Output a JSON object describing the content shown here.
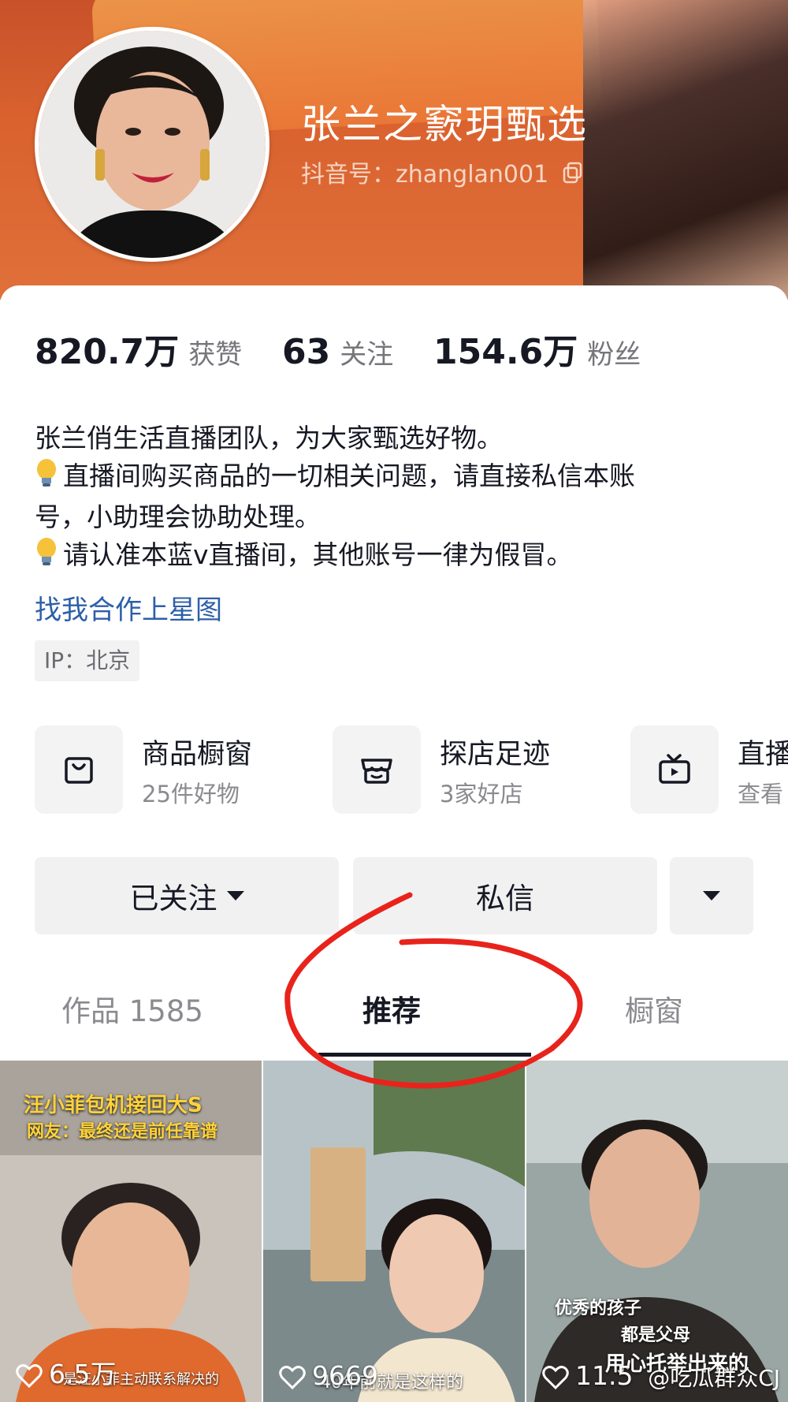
{
  "profile": {
    "name": "张兰之窾玥甄选",
    "douyin_id": "抖音号：zhanglan001"
  },
  "stats": [
    {
      "num": "820.7万",
      "label": "获赞"
    },
    {
      "num": "63",
      "label": "关注"
    },
    {
      "num": "154.6万",
      "label": "粉丝"
    }
  ],
  "bio": {
    "line1": "张兰俏生活直播团队，为大家甄选好物。",
    "line2": "直播间购买商品的一切相关问题，请直接私信本账",
    "line3": "号，小助理会协助处理。",
    "line4": "请认准本蓝v直播间，其他账号一律为假冒。"
  },
  "xingtu_link": "找我合作上星图",
  "ip_tag": "IP：北京",
  "features": [
    {
      "title": "商品橱窗",
      "sub": "25件好物",
      "icon": "shopping-bag-icon"
    },
    {
      "title": "探店足迹",
      "sub": "3家好店",
      "icon": "store-icon"
    },
    {
      "title": "直播",
      "sub": "查看",
      "icon": "tv-icon"
    }
  ],
  "buttons": {
    "follow": "已关注",
    "message": "私信"
  },
  "tabs": {
    "works": "作品 1585",
    "recommend": "推荐",
    "showcase": "橱窗"
  },
  "videos": [
    {
      "likes": "6.5万",
      "title1": "汪小菲包机接回大S",
      "title2": "网友：最终还是前任靠谱",
      "subtitle": "是汪小菲主动联系解决的"
    },
    {
      "likes": "9669",
      "subtitle": "40年前就是这样的"
    },
    {
      "likes": "11.5",
      "subtitle1": "优秀的孩子",
      "subtitle2": "都是父母",
      "subtitle3": "用心托举出来的"
    }
  ],
  "watermark": "@吃瓜群众CJ",
  "colors": {
    "banner": "#d9622f",
    "link": "#2d5fa8",
    "annotation": "#e8231c"
  }
}
